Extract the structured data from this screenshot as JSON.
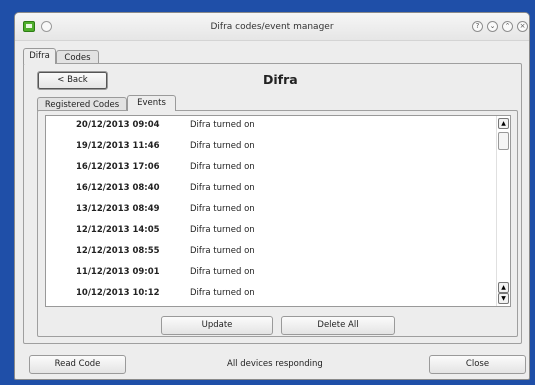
{
  "window": {
    "title": "Difra codes/event manager",
    "controls": [
      "help-icon",
      "minimize-icon",
      "maximize-icon",
      "close-icon"
    ],
    "control_glyphs": [
      "?",
      "⌄",
      "⌃",
      "×"
    ]
  },
  "outer_tabs": [
    "Difra",
    "Codes"
  ],
  "panel": {
    "back_label": "< Back",
    "heading": "Difra"
  },
  "inner_tabs": [
    "Registered Codes",
    "Events"
  ],
  "events": [
    {
      "date": "20/12/2013 09:04",
      "description": "Difra turned on"
    },
    {
      "date": "19/12/2013 11:46",
      "description": "Difra turned on"
    },
    {
      "date": "16/12/2013 17:06",
      "description": "Difra turned on"
    },
    {
      "date": "16/12/2013 08:40",
      "description": "Difra turned on"
    },
    {
      "date": "13/12/2013 08:49",
      "description": "Difra turned on"
    },
    {
      "date": "12/12/2013 14:05",
      "description": "Difra turned on"
    },
    {
      "date": "12/12/2013 08:55",
      "description": "Difra turned on"
    },
    {
      "date": "11/12/2013 09:01",
      "description": "Difra turned on"
    },
    {
      "date": "10/12/2013 10:12",
      "description": "Difra turned on"
    }
  ],
  "actions": {
    "update_label": "Update",
    "delete_all_label": "Delete All"
  },
  "footer": {
    "read_code_label": "Read Code",
    "status_text": "All devices responding",
    "close_label": "Close"
  },
  "colors": {
    "desktop": "#1f4fa8",
    "window_bg": "#ededed",
    "app_icon": "#4fae2c"
  }
}
